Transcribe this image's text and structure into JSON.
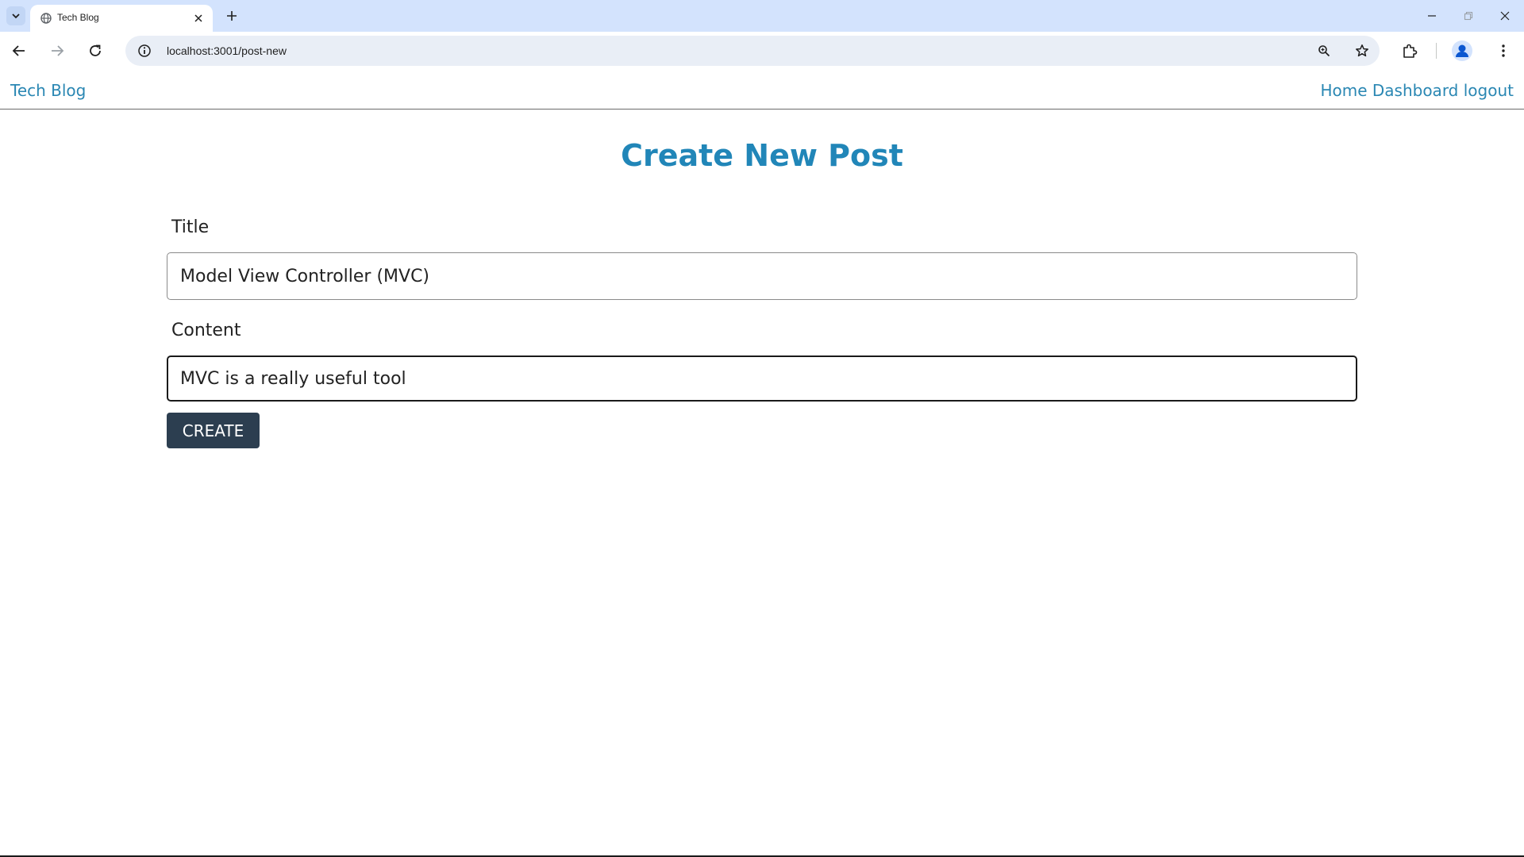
{
  "browser": {
    "tab_title": "Tech Blog",
    "url": "localhost:3001/post-new"
  },
  "site_nav": {
    "brand": "Tech Blog",
    "links": [
      "Home",
      "Dashboard",
      "logout"
    ]
  },
  "form": {
    "heading": "Create New Post",
    "title_label": "Title",
    "title_value": "Model View Controller (MVC)",
    "content_label": "Content",
    "content_value": "MVC is a really useful tool",
    "submit_label": "CREATE"
  },
  "colors": {
    "link": "#2a87b3",
    "heading": "#2186b8",
    "button": "#2c3e50",
    "tabstrip": "#d3e3fd"
  }
}
